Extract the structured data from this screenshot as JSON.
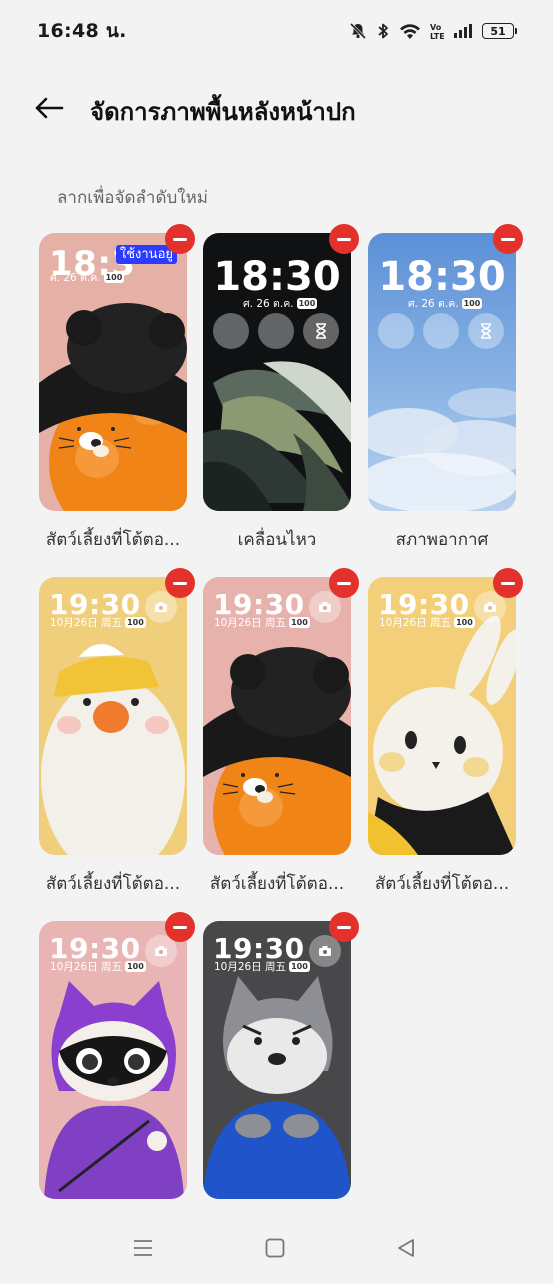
{
  "status": {
    "time": "16:48 น.",
    "battery": "51",
    "icons": [
      "bell-muted-icon",
      "bluetooth-icon",
      "wifi-icon",
      "volte-icon",
      "signal-icon",
      "battery-icon"
    ]
  },
  "header": {
    "title": "จัดการภาพพื้นหลังหน้าปก"
  },
  "hint": "ลากเพื่อจัดลำดับใหม่",
  "wallpapers": [
    {
      "label": "สัตว์เลี้ยงที่โต้ตอ...",
      "clock": "18:3",
      "date": "ศ. 26 ต.ค.",
      "battery": "100",
      "badge": "ใช้งานอยู่",
      "bg": "#e7b3a8"
    },
    {
      "label": "เคลื่อนไหว",
      "clock": "18:30",
      "date": "ศ. 26 ต.ค.",
      "battery": "100",
      "bg": "#101214"
    },
    {
      "label": "สภาพอากาศ",
      "clock": "18:30",
      "date": "ศ. 26 ต.ค.",
      "battery": "100",
      "bg": "#6f9fdc"
    },
    {
      "label": "สัตว์เลี้ยงที่โต้ตอ...",
      "clock": "19:30",
      "date": "10月26日 周五",
      "battery": "100",
      "bg": "#f0cf7c"
    },
    {
      "label": "สัตว์เลี้ยงที่โต้ตอ...",
      "clock": "19:30",
      "date": "10月26日 周五",
      "battery": "100",
      "bg": "#e8b2ac"
    },
    {
      "label": "สัตว์เลี้ยงที่โต้ตอ...",
      "clock": "19:30",
      "date": "10月26日 周五",
      "battery": "100",
      "bg": "#f2cf78"
    },
    {
      "label": "",
      "clock": "19:30",
      "date": "10月26日 周五",
      "battery": "100",
      "bg": "#e9b4b4"
    },
    {
      "label": "",
      "clock": "19:30",
      "date": "10月26日 周五",
      "battery": "100",
      "bg": "#4a4a4c"
    }
  ],
  "colors": {
    "remove": "#e4312b",
    "in_use_badge": "#2c3cff",
    "background": "#f3f3f3"
  },
  "nav": [
    "menu-icon",
    "home-icon",
    "back-icon"
  ]
}
